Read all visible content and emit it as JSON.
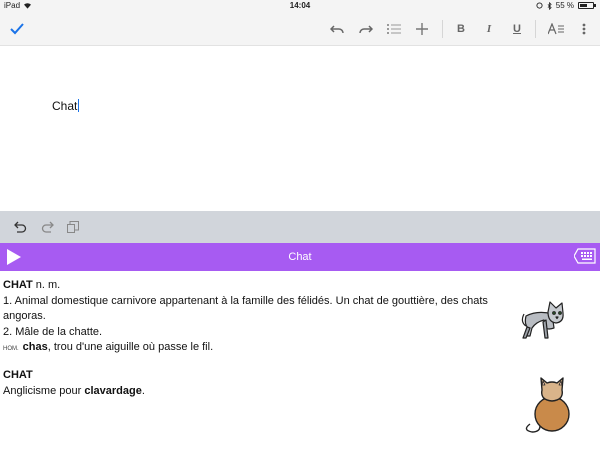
{
  "status_bar": {
    "device": "iPad",
    "time": "14:04",
    "battery": "55 %",
    "battery_level": 0.55
  },
  "toolbar": {
    "icons": [
      "check-icon",
      "undo-icon",
      "redo-icon",
      "list-icon",
      "plus-icon",
      "bold-icon",
      "italic-icon",
      "underline-icon",
      "text-format-icon",
      "more-vertical-icon"
    ],
    "bold_label": "B",
    "italic_label": "I",
    "underline_label": "U",
    "accent": "#1a73e8"
  },
  "editor": {
    "text": "Chat"
  },
  "undo_bar": {
    "icons": [
      "undo-arrow-icon",
      "redo-arrow-icon",
      "copy-icon"
    ]
  },
  "purple_bar": {
    "title": "Chat",
    "color": "#a75bf2"
  },
  "entry1": {
    "headword": "CHAT",
    "pos": " n. m.",
    "def1": "1. Animal domestique carnivore appartenant à la famille des félidés. Un chat de gouttière, des chats angoras.",
    "def2": "2. Mâle de la chatte.",
    "hom_tag": "HOM.",
    "hom_word": "chas",
    "hom_rest": ", trou d'une aiguille où passe le fil."
  },
  "entry2": {
    "headword": "CHAT",
    "def_prefix": "Anglicisme pour ",
    "def_bold": "clavardage",
    "def_suffix": "."
  }
}
